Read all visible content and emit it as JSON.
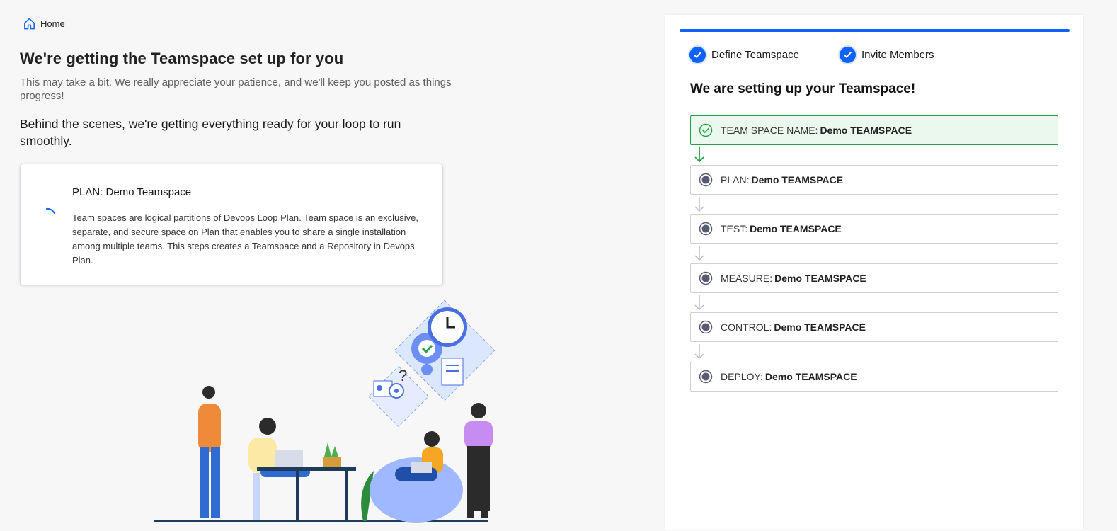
{
  "breadcrumb": {
    "label": "Home"
  },
  "page": {
    "title": "We're getting the Teamspace set up for you",
    "subtitle": "This may take a bit. We really appreciate your patience, and we'll keep you posted as things progress!",
    "behind_text": "Behind the scenes, we're getting everything ready for your loop to run smoothly."
  },
  "plan_card": {
    "title": "PLAN: Demo Teamspace",
    "description": "Team spaces are logical partitions of Devops Loop Plan. Team space is an exclusive, separate, and secure space on Plan that enables you to share a single installation among multiple teams. This steps creates a Teamspace and a Repository in Devops Plan."
  },
  "wizard": {
    "steps": [
      {
        "label": "Define Teamspace",
        "status": "complete"
      },
      {
        "label": "Invite Members",
        "status": "complete"
      }
    ],
    "heading": "We are setting up your Teamspace!"
  },
  "setup_steps": [
    {
      "label": "TEAM SPACE NAME:",
      "value": "Demo TEAMSPACE",
      "status": "done"
    },
    {
      "label": "PLAN:",
      "value": "Demo TEAMSPACE",
      "status": "pending"
    },
    {
      "label": "TEST:",
      "value": "Demo TEAMSPACE",
      "status": "pending"
    },
    {
      "label": "MEASURE:",
      "value": "Demo TEAMSPACE",
      "status": "pending"
    },
    {
      "label": "CONTROL:",
      "value": "Demo TEAMSPACE",
      "status": "pending"
    },
    {
      "label": "DEPLOY:",
      "value": "Demo TEAMSPACE",
      "status": "pending"
    }
  ],
  "colors": {
    "accent": "#0f62fe",
    "success": "#24a148",
    "success_bg": "#ebf8ee",
    "pending": "#5a5a72"
  }
}
